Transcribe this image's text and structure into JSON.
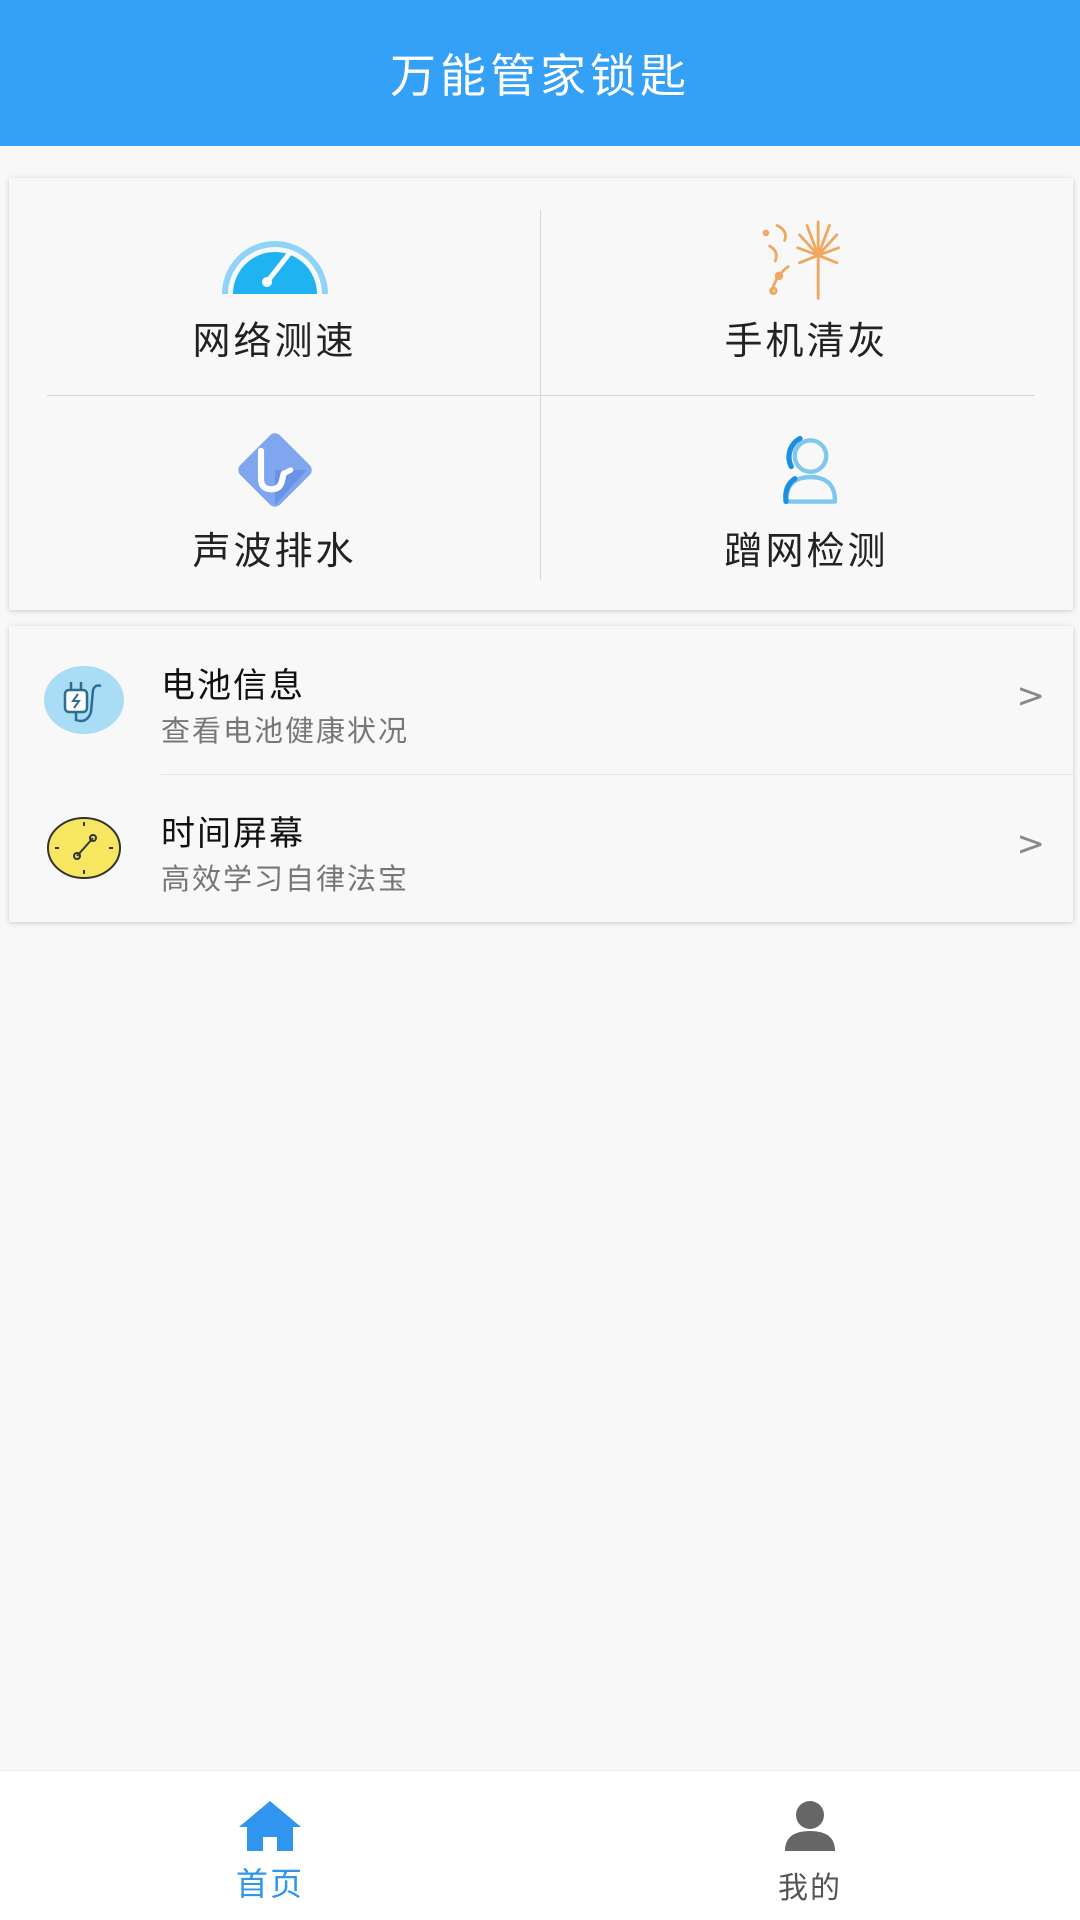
{
  "header": {
    "title": "万能管家锁匙"
  },
  "tools": [
    {
      "label": "网络测速",
      "icon": "speedometer-icon"
    },
    {
      "label": "手机清灰",
      "icon": "brush-icon"
    },
    {
      "label": "声波排水",
      "icon": "drain-pipe-icon"
    },
    {
      "label": "蹭网检测",
      "icon": "user-icon"
    }
  ],
  "list": [
    {
      "title": "电池信息",
      "subtitle": "查看电池健康状况",
      "icon": "battery-plug-icon",
      "chevron": ">"
    },
    {
      "title": "时间屏幕",
      "subtitle": "高效学习自律法宝",
      "icon": "clock-icon",
      "chevron": ">"
    }
  ],
  "tabbar": {
    "items": [
      {
        "label": "首页",
        "icon": "home-icon",
        "active": true
      },
      {
        "label": "我的",
        "icon": "profile-icon",
        "active": false
      }
    ]
  },
  "colors": {
    "primary": "#34a0f6",
    "tab_active": "#2f95ef",
    "tab_inactive": "#555555",
    "background": "#f8f8f8"
  }
}
